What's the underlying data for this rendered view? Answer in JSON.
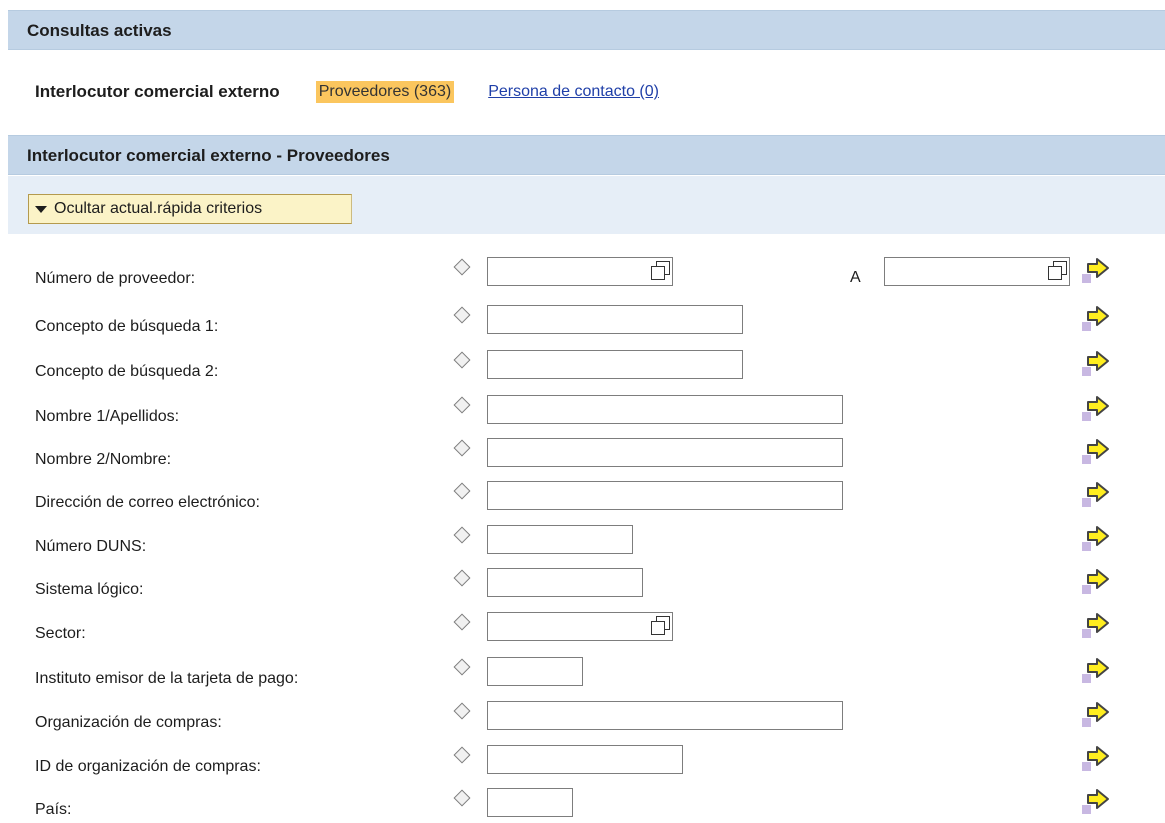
{
  "section1": {
    "title": "Consultas activas"
  },
  "tabs": {
    "title": "Interlocutor comercial externo",
    "active": "Proveedores (363)",
    "other": "Persona de contacto (0)"
  },
  "section2": {
    "title": "Interlocutor comercial externo - Proveedores"
  },
  "toggle": {
    "label": "Ocultar actual.rápida criterios"
  },
  "to_label": "A",
  "fields": [
    {
      "label": "Número de proveedor:",
      "value": ""
    },
    {
      "label": "Concepto de búsqueda 1:",
      "value": ""
    },
    {
      "label": "Concepto de búsqueda 2:",
      "value": ""
    },
    {
      "label": "Nombre 1/Apellidos:",
      "value": ""
    },
    {
      "label": "Nombre 2/Nombre:",
      "value": ""
    },
    {
      "label": "Dirección de correo electrónico:",
      "value": ""
    },
    {
      "label": "Número DUNS:",
      "value": ""
    },
    {
      "label": "Sistema lógico:",
      "value": ""
    },
    {
      "label": "Sector:",
      "value": ""
    },
    {
      "label": "Instituto emisor de la tarjeta de pago:",
      "value": ""
    },
    {
      "label": "Organización de compras:",
      "value": ""
    },
    {
      "label": "ID de organización de compras:",
      "value": ""
    },
    {
      "label": "País:",
      "value": ""
    }
  ],
  "colors": {
    "header_bar": "#c4d6e9",
    "active_tab": "#fbc65e",
    "link": "#1f3fa8",
    "toggle_bg": "#fbf3c7"
  },
  "icons": {
    "selection_option": "diamond-icon",
    "value_help": "value-help-icon",
    "multiple_selection": "arrow-right-icon"
  }
}
